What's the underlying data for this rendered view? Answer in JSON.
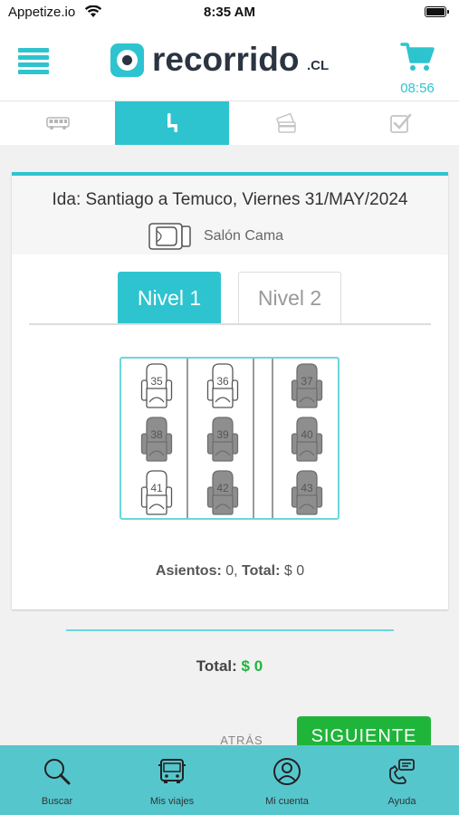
{
  "status_bar": {
    "carrier": "Appetize.io",
    "time": "8:35 AM"
  },
  "header": {
    "brand": "recorrido",
    "brand_suffix": ".CL",
    "timer": "08:56"
  },
  "steps": [
    {
      "icon": "bus-icon",
      "active": false
    },
    {
      "icon": "seat-icon",
      "active": true
    },
    {
      "icon": "payment-icon",
      "active": false
    },
    {
      "icon": "checkbox-icon",
      "active": false
    }
  ],
  "trip": {
    "route": "Ida: Santiago a Temuco, Viernes 31/MAY/2024",
    "bus_type": "Salón Cama"
  },
  "levels": {
    "level1": "Nivel 1",
    "level2": "Nivel 2"
  },
  "seats": [
    {
      "number": "35",
      "status": "available"
    },
    {
      "number": "36",
      "status": "available"
    },
    {
      "number": "37",
      "status": "occupied"
    },
    {
      "number": "38",
      "status": "occupied"
    },
    {
      "number": "39",
      "status": "occupied"
    },
    {
      "number": "40",
      "status": "occupied"
    },
    {
      "number": "41",
      "status": "available"
    },
    {
      "number": "42",
      "status": "occupied"
    },
    {
      "number": "43",
      "status": "occupied"
    }
  ],
  "summary": {
    "seats_label": "Asientos:",
    "seats_value": " 0, ",
    "total_label": "Total:",
    "total_value": " $ 0"
  },
  "total": {
    "label": "Total:",
    "amount": "$ 0"
  },
  "actions": {
    "back": "ATRÁS",
    "next": "SIGUIENTE"
  },
  "bottom_nav": [
    {
      "label": "Buscar",
      "icon": "search-icon"
    },
    {
      "label": "Mis viajes",
      "icon": "bus-front-icon"
    },
    {
      "label": "Mi cuenta",
      "icon": "user-icon"
    },
    {
      "label": "Ayuda",
      "icon": "help-icon"
    }
  ],
  "colors": {
    "accent": "#2ec4cf",
    "success": "#1fb53a",
    "nav_bg": "#56c6cd",
    "occupied_seat": "#8e8e8e"
  }
}
